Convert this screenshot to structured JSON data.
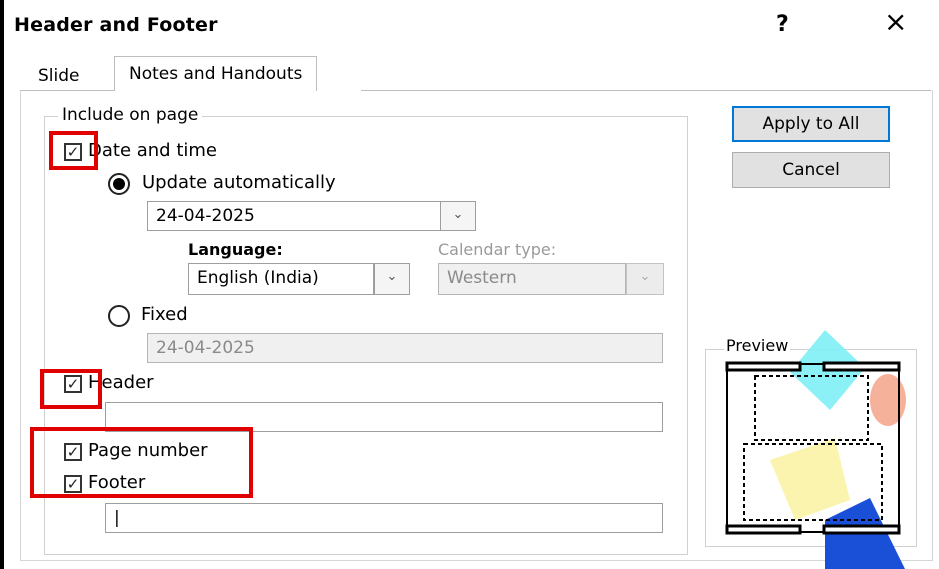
{
  "window": {
    "title": "Header and Footer",
    "help_icon": "?",
    "close_icon": "×"
  },
  "tabs": [
    {
      "label": "Slide",
      "active": false
    },
    {
      "label": "Notes and Handouts",
      "active": true
    }
  ],
  "include_on_page": {
    "legend": "Include on page",
    "date_and_time": {
      "label": "Date and time",
      "checked": true
    },
    "update_automatically": {
      "label": "Update automatically",
      "selected": true,
      "value": "24-04-2025",
      "dropdown_icon": "⌄"
    },
    "language": {
      "label": "Language:",
      "value": "English (India)",
      "dropdown_icon": "⌄"
    },
    "calendar_type": {
      "label": "Calendar type:",
      "value": "Western",
      "dropdown_icon": "⌄"
    },
    "fixed": {
      "label": "Fixed",
      "selected": false,
      "value": "24-04-2025"
    },
    "header": {
      "label": "Header",
      "checked": true,
      "value": ""
    },
    "page_number": {
      "label": "Page number",
      "checked": true
    },
    "footer": {
      "label": "Footer",
      "checked": true,
      "value": "|"
    }
  },
  "buttons": {
    "apply_to_all": "Apply to All",
    "cancel": "Cancel"
  },
  "preview": {
    "legend": "Preview"
  },
  "check_glyph": "✓",
  "colors": {
    "highlight": "#e00000",
    "accent": "#0078d7"
  }
}
